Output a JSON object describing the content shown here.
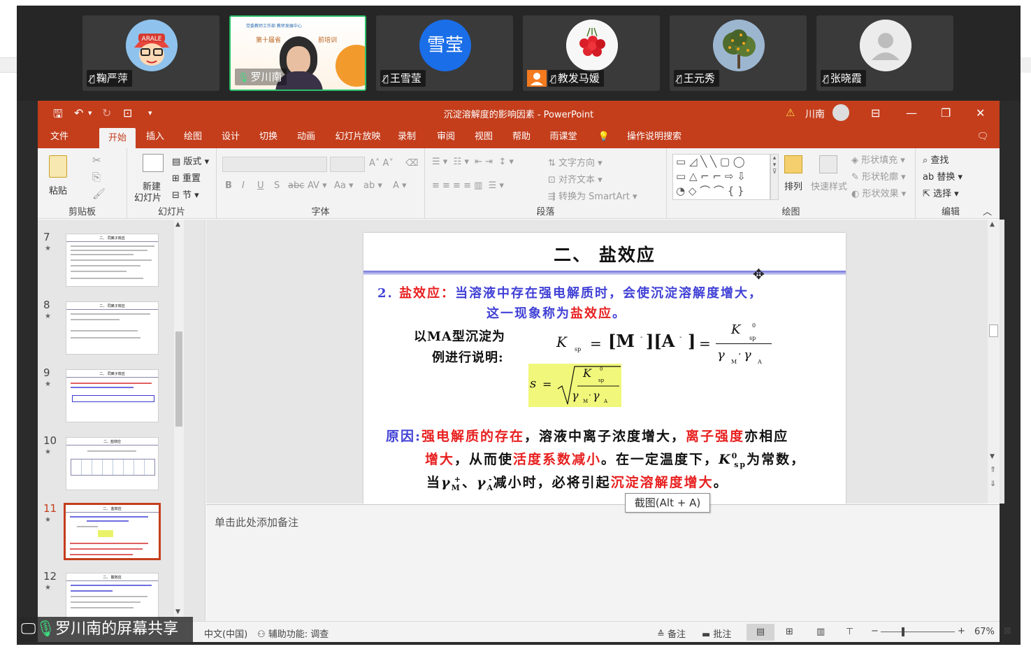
{
  "participants": [
    {
      "name": "鞠严萍",
      "avatar": "cartoon"
    },
    {
      "name": "罗川南",
      "avatar": "video",
      "thumb_lines": [
        "党委教师工作部 教师发展中心",
        "第十届省",
        "前培训"
      ]
    },
    {
      "name": "王雪莹",
      "avatar": "text",
      "avatar_text": "雪莹"
    },
    {
      "name": "教发马媛",
      "avatar": "cherries"
    },
    {
      "name": "王元秀",
      "avatar": "tree"
    },
    {
      "name": "张晓霞",
      "avatar": "default"
    }
  ],
  "share_label": "罗川南的屏幕共享",
  "tooltip": "截图(Alt + A)",
  "ppt": {
    "window_title": "沉淀溶解度的影响因素 - PowerPoint",
    "user": "川南",
    "tabs": [
      "文件",
      "开始",
      "插入",
      "绘图",
      "设计",
      "切换",
      "动画",
      "幻灯片放映",
      "录制",
      "审阅",
      "视图",
      "帮助",
      "雨课堂"
    ],
    "active_tab": "开始",
    "tell_me": "操作说明搜索",
    "ribbon": {
      "clipboard": {
        "label": "剪贴板",
        "paste": "粘贴"
      },
      "slides": {
        "label": "幻灯片",
        "new_slide_1": "新建",
        "new_slide_2": "幻灯片",
        "layout": "版式",
        "reset": "重置",
        "section": "节"
      },
      "font": {
        "label": "字体"
      },
      "paragraph": {
        "label": "段落",
        "text_direction": "文字方向",
        "align_text": "对齐文本",
        "convert_smartart": "转换为 SmartArt"
      },
      "drawing": {
        "label": "绘图",
        "arrange": "排列",
        "quick_styles": "快速样式",
        "shape_fill": "形状填充",
        "shape_outline": "形状轮廓",
        "shape_effects": "形状效果"
      },
      "editing": {
        "label": "编辑",
        "find": "查找",
        "replace": "替换",
        "select": "选择"
      }
    },
    "thumbnails": [
      {
        "num": "7",
        "title": "二、 同离子效应"
      },
      {
        "num": "8",
        "title": "二、 同离子效应"
      },
      {
        "num": "9",
        "title": "二、 同离子效应"
      },
      {
        "num": "10",
        "title": "二、盐效应"
      },
      {
        "num": "11",
        "title": "二、 盐效应"
      },
      {
        "num": "12",
        "title": "二、 酸效应"
      }
    ],
    "selected_slide": "11",
    "slide": {
      "title": "二、 盐效应",
      "p1_num": "2. ",
      "p1_red": "盐效应：",
      "p1_blue": "当溶液中存在强电解质时，会使沉淀溶解度增大，",
      "p1_blue2": "这一现象称为",
      "p1_red2": "盐效应",
      "p1_end": "。",
      "left_1": "以MA型沉淀为",
      "left_2": "例进行说明:",
      "f_K": "K",
      "f_sp": "sp",
      "f_eq": "=",
      "f_M": "[M",
      "f_A": "][A",
      "f_close": "]",
      "f_eq2": "=",
      "f_K0": "K",
      "f_0": "0",
      "f_sp2": "sp",
      "f_gamma": "γ",
      "f_Msub": "M",
      "f_dot": "·",
      "f_gamma2": "γ",
      "f_Asub": "A",
      "f_minus": "-",
      "s_s": "s",
      "s_eq": "=",
      "reason_lbl": "原因:",
      "r1a": "强电解质的存在",
      "r1b": "，溶液中离子浓度增大，",
      "r1c": "离子强度",
      "r1d": "亦相应",
      "r2a": "增大",
      "r2b": "，从而使",
      "r2c": "活度系数减小",
      "r2d": "。在一定温度下，",
      "r2e": "K",
      "r2f": "0",
      "r2g": "sp",
      "r2h": "为常数，",
      "r3a": "当",
      "r3b": "γ",
      "r3c": "M",
      "r3d": "+",
      "r3e": "、",
      "r3f": "γ",
      "r3g": "A",
      "r3h": "-",
      "r3i": "减小时，必将引起",
      "r3j": "沉淀溶解度增大",
      "r3k": "。"
    },
    "notes_placeholder": "单击此处添加备注",
    "status": {
      "lang": "中文(中国)",
      "accessibility": "辅助功能: 调查",
      "notes": "备注",
      "comments": "批注",
      "zoom": "67%"
    }
  },
  "colors": {
    "ppt_accent": "#c43e1c",
    "active_speaker": "#2cbf6a",
    "slide_blue": "#4141d6",
    "slide_red": "#e82020"
  }
}
